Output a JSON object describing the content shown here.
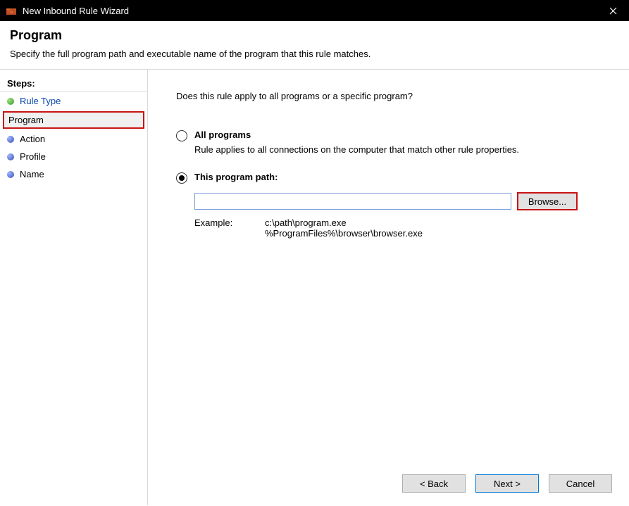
{
  "titlebar": {
    "title": "New Inbound Rule Wizard"
  },
  "header": {
    "title": "Program",
    "subtitle": "Specify the full program path and executable name of the program that this rule matches."
  },
  "sidebar": {
    "steps_label": "Steps:",
    "items": [
      {
        "label": "Rule Type",
        "bullet": "green",
        "link": true
      },
      {
        "label": "Program",
        "bullet": "green",
        "current": true
      },
      {
        "label": "Action",
        "bullet": "blue"
      },
      {
        "label": "Profile",
        "bullet": "blue"
      },
      {
        "label": "Name",
        "bullet": "blue"
      }
    ]
  },
  "main": {
    "question": "Does this rule apply to all programs or a specific program?",
    "option_all": {
      "label": "All programs",
      "desc": "Rule applies to all connections on the computer that match other rule properties."
    },
    "option_path": {
      "label": "This program path:",
      "value": "",
      "browse_label": "Browse..."
    },
    "example": {
      "label": "Example:",
      "line1": "c:\\path\\program.exe",
      "line2": "%ProgramFiles%\\browser\\browser.exe"
    }
  },
  "buttons": {
    "back": "< Back",
    "next": "Next >",
    "cancel": "Cancel"
  }
}
